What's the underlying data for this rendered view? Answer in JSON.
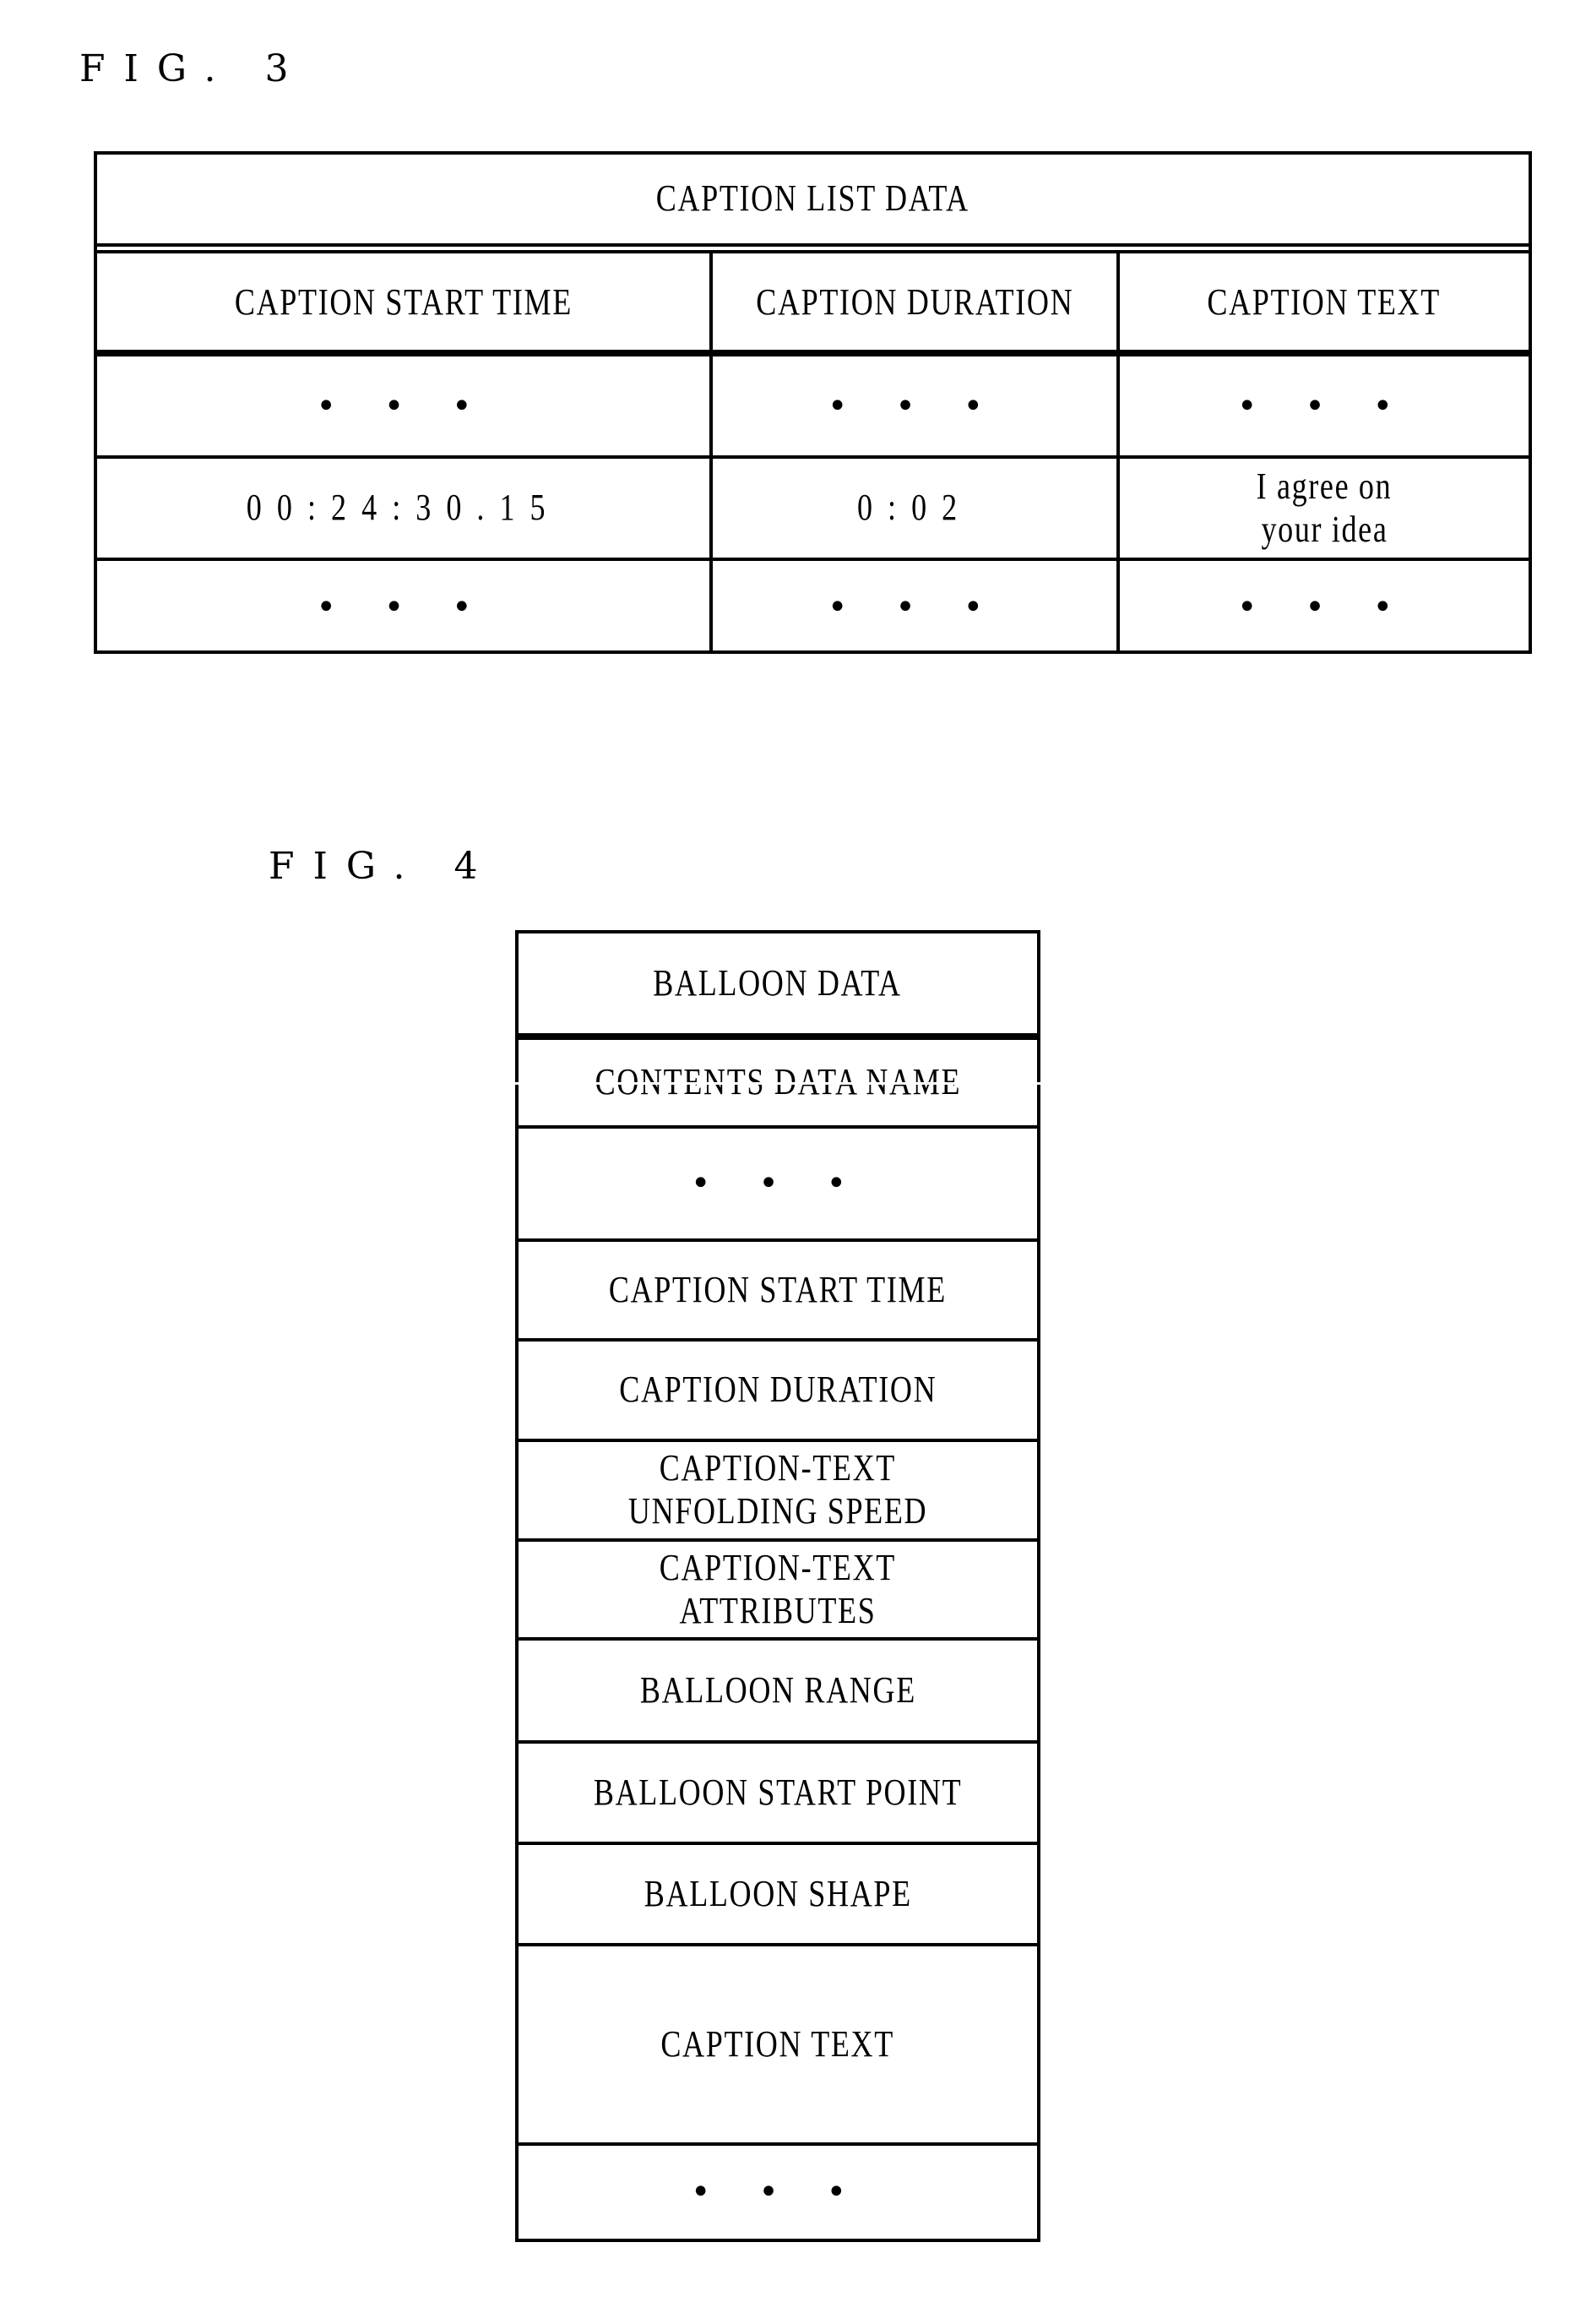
{
  "fig3": {
    "label": "FIG. 3",
    "table_title": "CAPTION LIST DATA",
    "columns": [
      "CAPTION START TIME",
      "CAPTION DURATION",
      "CAPTION TEXT"
    ],
    "rows": [
      [
        "• • •",
        "• • •",
        "• • •"
      ],
      [
        "00:24:30.15",
        "0:02",
        "I agree on your idea"
      ],
      [
        "• • •",
        "• • •",
        "• • •"
      ]
    ],
    "caption_text_lines": [
      "I agree on",
      "your idea"
    ]
  },
  "fig4": {
    "label": "FIG. 4",
    "title": "BALLOON DATA",
    "fields": [
      "CONTENTS DATA NAME",
      "• • •",
      "CAPTION START TIME",
      "CAPTION DURATION",
      "CAPTION-TEXT UNFOLDING SPEED",
      "CAPTION-TEXT ATTRIBUTES",
      "BALLOON RANGE",
      "BALLOON START POINT",
      "BALLOON SHAPE",
      "CAPTION TEXT",
      "• • •"
    ],
    "field_lines": {
      "unfolding": [
        "CAPTION-TEXT",
        "UNFOLDING SPEED"
      ],
      "attributes": [
        "CAPTION-TEXT",
        "ATTRIBUTES"
      ]
    }
  }
}
